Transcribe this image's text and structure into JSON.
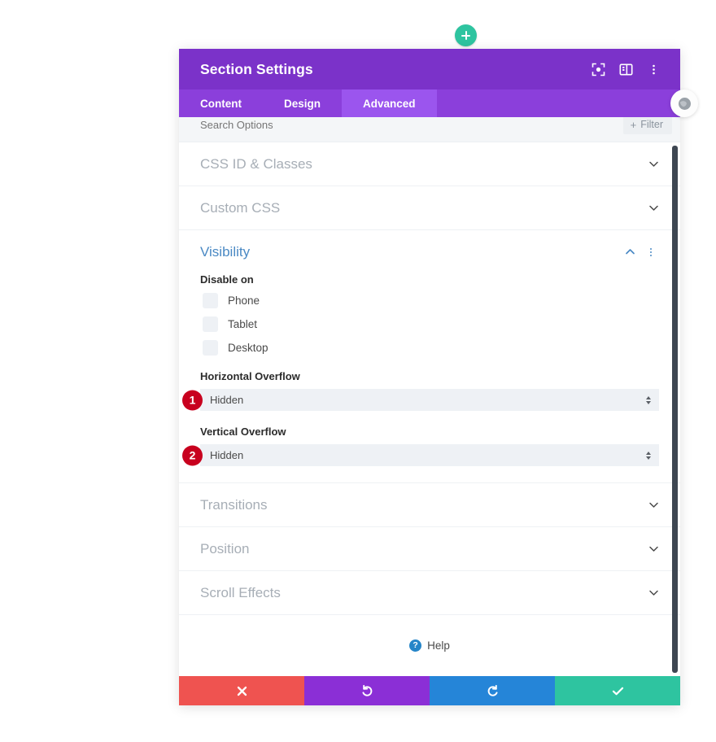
{
  "add_button": {
    "icon": "plus-icon"
  },
  "modal": {
    "title": "Section Settings",
    "header_icons": [
      {
        "name": "focus-frame-icon"
      },
      {
        "name": "panel-layout-icon"
      },
      {
        "name": "vertical-dots-icon"
      }
    ],
    "tabs": [
      {
        "label": "Content",
        "active": false
      },
      {
        "label": "Design",
        "active": false
      },
      {
        "label": "Advanced",
        "active": true
      }
    ],
    "search": {
      "placeholder": "Search Options",
      "value": ""
    },
    "filter_button": {
      "label": "Filter",
      "icon": "plus-icon"
    },
    "sections": [
      {
        "title": "CSS ID & Classes",
        "state": "collapsed",
        "icon": "chevron-down-icon"
      },
      {
        "title": "Custom CSS",
        "state": "collapsed",
        "icon": "chevron-down-icon"
      },
      {
        "title": "Visibility",
        "state": "expanded",
        "icon": "chevron-up-icon"
      },
      {
        "title": "Transitions",
        "state": "collapsed",
        "icon": "chevron-down-icon"
      },
      {
        "title": "Position",
        "state": "collapsed",
        "icon": "chevron-down-icon"
      },
      {
        "title": "Scroll Effects",
        "state": "collapsed",
        "icon": "chevron-down-icon"
      }
    ],
    "visibility": {
      "title": "Visibility",
      "disable_on_label": "Disable on",
      "checkboxes": [
        {
          "label": "Phone",
          "checked": false
        },
        {
          "label": "Tablet",
          "checked": false
        },
        {
          "label": "Desktop",
          "checked": false
        }
      ],
      "horizontal_overflow": {
        "label": "Horizontal Overflow",
        "value": "Hidden",
        "badge": "1"
      },
      "vertical_overflow": {
        "label": "Vertical Overflow",
        "value": "Hidden",
        "badge": "2"
      }
    },
    "help": {
      "label": "Help",
      "icon": "question-mark-icon"
    },
    "footer_buttons": [
      {
        "name": "cancel-button",
        "icon": "close-x-icon",
        "color": "#ef5350"
      },
      {
        "name": "undo-button",
        "icon": "undo-arrow-icon",
        "color": "#8b2fd6"
      },
      {
        "name": "redo-button",
        "icon": "redo-arrow-icon",
        "color": "#2585d8"
      },
      {
        "name": "save-button",
        "icon": "checkmark-icon",
        "color": "#2ec4a0"
      }
    ]
  },
  "colors": {
    "header_purple": "#7b32c9",
    "tabbar_purple": "#8b3fdb",
    "tab_active_purple": "#9b55ee",
    "accent_blue": "#4a89c4",
    "badge_red": "#c8001e",
    "green": "#2ec4a0"
  },
  "right_puck": {
    "icon": "close-circle-icon"
  }
}
